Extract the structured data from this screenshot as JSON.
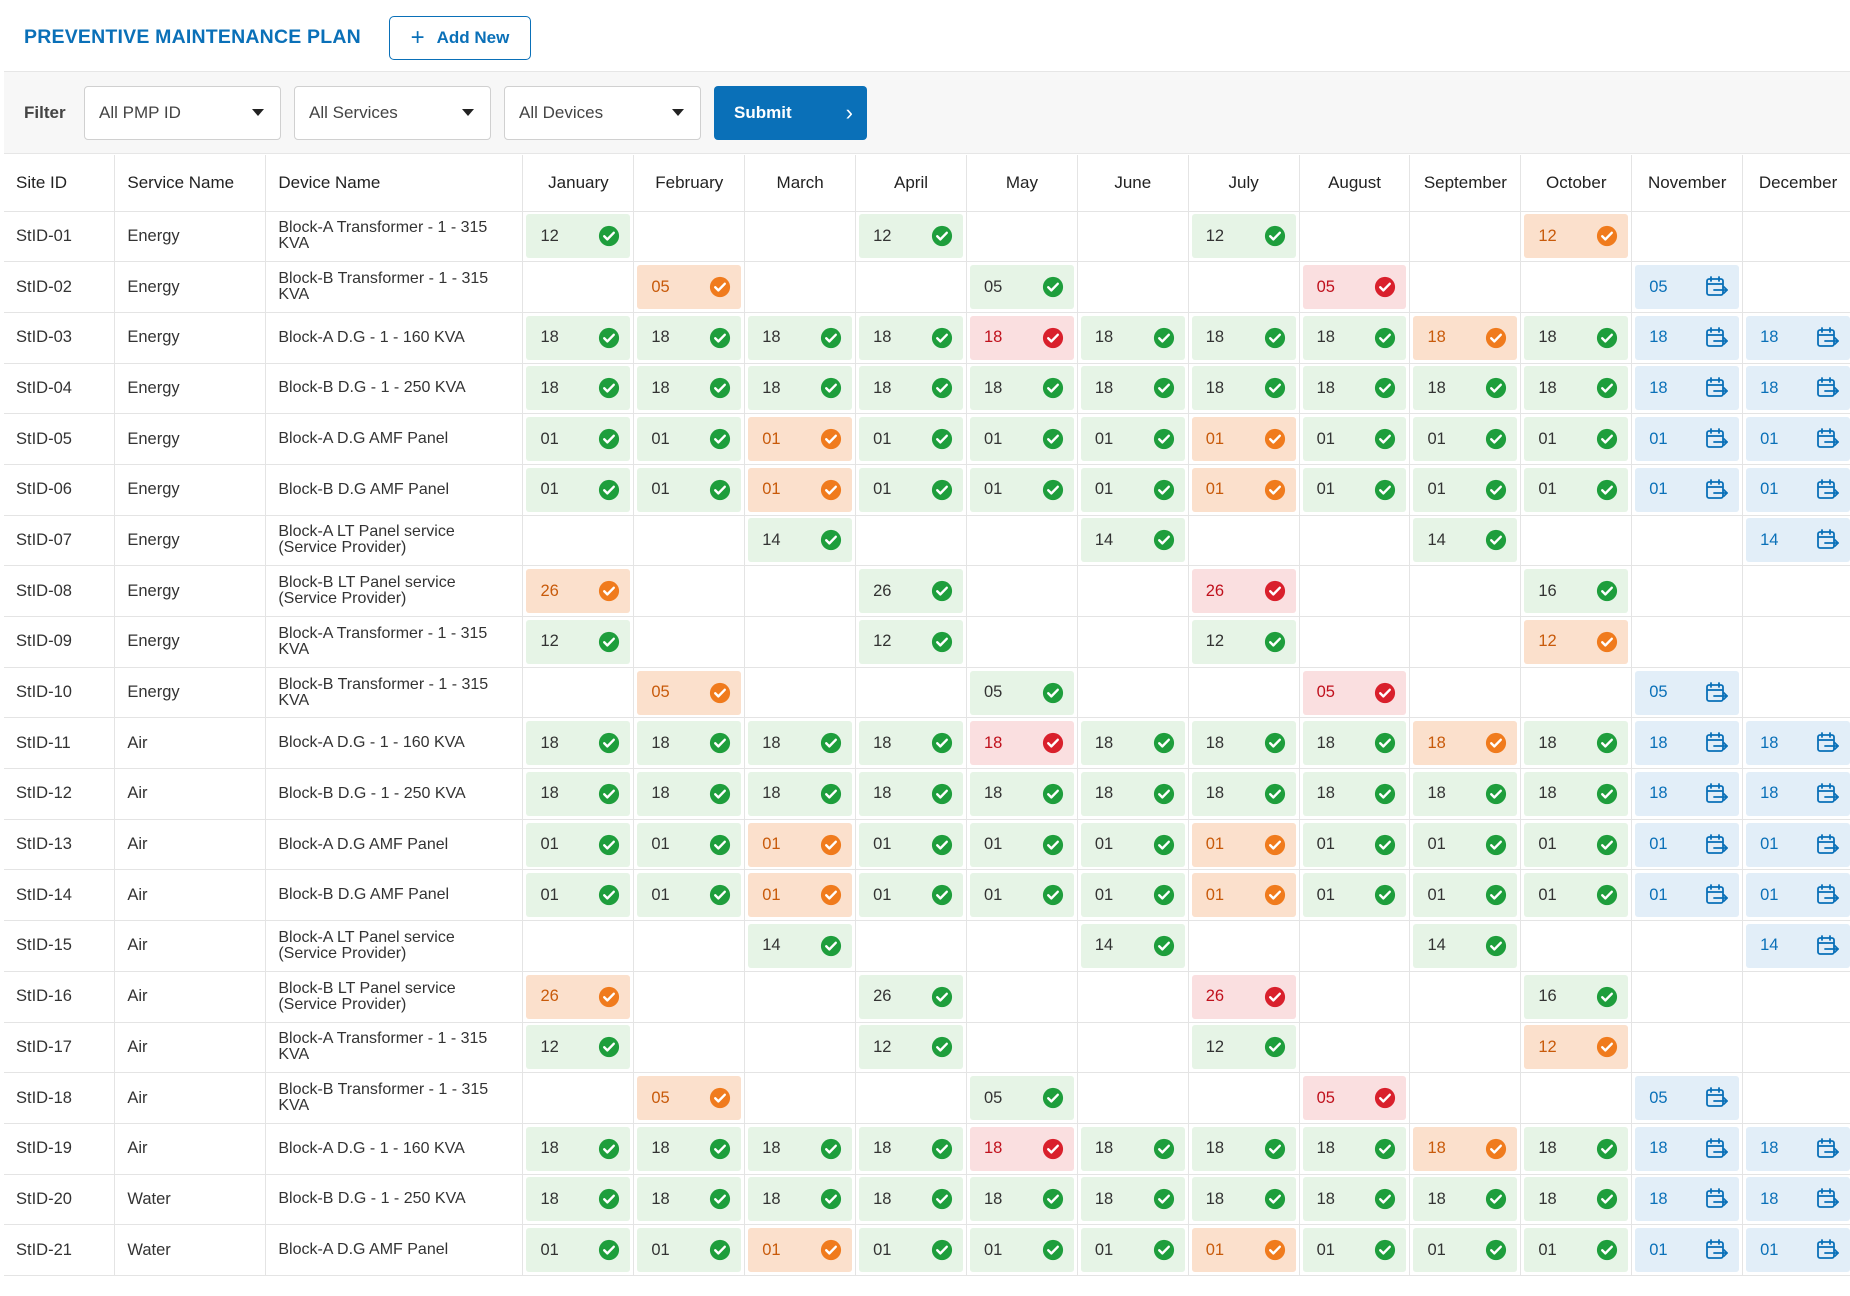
{
  "header": {
    "title": "PREVENTIVE MAINTENANCE PLAN",
    "add_label": "Add New"
  },
  "filter": {
    "label": "Filter",
    "pmp": "All PMP ID",
    "services": "All Services",
    "devices": "All Devices",
    "submit_label": "Submit"
  },
  "columns": [
    "Site ID",
    "Service Name",
    "Device Name"
  ],
  "months": [
    "January",
    "February",
    "March",
    "April",
    "May",
    "June",
    "July",
    "August",
    "September",
    "October",
    "November",
    "December"
  ],
  "status_colors": {
    "green": "#1e9e3c",
    "orange": "#f07b1d",
    "red": "#d9202c",
    "blue": "#0a70b8"
  },
  "status_icons": {
    "green": "check-circle-icon",
    "orange": "check-circle-icon",
    "red": "check-circle-icon",
    "blue": "calendar-arrow-icon"
  },
  "rows": [
    {
      "site": "StID-01",
      "service": "Energy",
      "device": [
        "Block-A Transformer - 1 - 315",
        "KVA"
      ],
      "cells": [
        [
          "12",
          "g"
        ],
        null,
        null,
        [
          "12",
          "g"
        ],
        null,
        null,
        [
          "12",
          "g"
        ],
        null,
        null,
        [
          "12",
          "o"
        ],
        null,
        null
      ]
    },
    {
      "site": "StID-02",
      "service": "Energy",
      "device": [
        "Block-B Transformer - 1 - 315",
        "KVA"
      ],
      "cells": [
        null,
        [
          "05",
          "o"
        ],
        null,
        null,
        [
          "05",
          "g"
        ],
        null,
        null,
        [
          "05",
          "r"
        ],
        null,
        null,
        [
          "05",
          "b"
        ],
        null
      ]
    },
    {
      "site": "StID-03",
      "service": "Energy",
      "device": [
        "Block-A D.G - 1 - 160 KVA"
      ],
      "cells": [
        [
          "18",
          "g"
        ],
        [
          "18",
          "g"
        ],
        [
          "18",
          "g"
        ],
        [
          "18",
          "g"
        ],
        [
          "18",
          "r"
        ],
        [
          "18",
          "g"
        ],
        [
          "18",
          "g"
        ],
        [
          "18",
          "g"
        ],
        [
          "18",
          "o"
        ],
        [
          "18",
          "g"
        ],
        [
          "18",
          "b"
        ],
        [
          "18",
          "b"
        ]
      ]
    },
    {
      "site": "StID-04",
      "service": "Energy",
      "device": [
        "Block-B D.G - 1 - 250 KVA"
      ],
      "cells": [
        [
          "18",
          "g"
        ],
        [
          "18",
          "g"
        ],
        [
          "18",
          "g"
        ],
        [
          "18",
          "g"
        ],
        [
          "18",
          "g"
        ],
        [
          "18",
          "g"
        ],
        [
          "18",
          "g"
        ],
        [
          "18",
          "g"
        ],
        [
          "18",
          "g"
        ],
        [
          "18",
          "g"
        ],
        [
          "18",
          "b"
        ],
        [
          "18",
          "b"
        ]
      ]
    },
    {
      "site": "StID-05",
      "service": "Energy",
      "device": [
        "Block-A D.G AMF Panel"
      ],
      "cells": [
        [
          "01",
          "g"
        ],
        [
          "01",
          "g"
        ],
        [
          "01",
          "o"
        ],
        [
          "01",
          "g"
        ],
        [
          "01",
          "g"
        ],
        [
          "01",
          "g"
        ],
        [
          "01",
          "o"
        ],
        [
          "01",
          "g"
        ],
        [
          "01",
          "g"
        ],
        [
          "01",
          "g"
        ],
        [
          "01",
          "b"
        ],
        [
          "01",
          "b"
        ]
      ]
    },
    {
      "site": "StID-06",
      "service": "Energy",
      "device": [
        "Block-B D.G AMF Panel"
      ],
      "cells": [
        [
          "01",
          "g"
        ],
        [
          "01",
          "g"
        ],
        [
          "01",
          "o"
        ],
        [
          "01",
          "g"
        ],
        [
          "01",
          "g"
        ],
        [
          "01",
          "g"
        ],
        [
          "01",
          "o"
        ],
        [
          "01",
          "g"
        ],
        [
          "01",
          "g"
        ],
        [
          "01",
          "g"
        ],
        [
          "01",
          "b"
        ],
        [
          "01",
          "b"
        ]
      ]
    },
    {
      "site": "StID-07",
      "service": "Energy",
      "device": [
        "Block-A LT Panel service",
        "(Service Provider)"
      ],
      "cells": [
        null,
        null,
        [
          "14",
          "g"
        ],
        null,
        null,
        [
          "14",
          "g"
        ],
        null,
        null,
        [
          "14",
          "g"
        ],
        null,
        null,
        [
          "14",
          "b"
        ]
      ]
    },
    {
      "site": "StID-08",
      "service": "Energy",
      "device": [
        "Block-B LT Panel service",
        "(Service Provider)"
      ],
      "cells": [
        [
          "26",
          "o"
        ],
        null,
        null,
        [
          "26",
          "g"
        ],
        null,
        null,
        [
          "26",
          "r"
        ],
        null,
        null,
        [
          "16",
          "g"
        ],
        null,
        null
      ]
    },
    {
      "site": "StID-09",
      "service": "Energy",
      "device": [
        "Block-A Transformer - 1 - 315",
        "KVA"
      ],
      "cells": [
        [
          "12",
          "g"
        ],
        null,
        null,
        [
          "12",
          "g"
        ],
        null,
        null,
        [
          "12",
          "g"
        ],
        null,
        null,
        [
          "12",
          "o"
        ],
        null,
        null
      ]
    },
    {
      "site": "StID-10",
      "service": "Energy",
      "device": [
        "Block-B Transformer - 1 - 315",
        "KVA"
      ],
      "cells": [
        null,
        [
          "05",
          "o"
        ],
        null,
        null,
        [
          "05",
          "g"
        ],
        null,
        null,
        [
          "05",
          "r"
        ],
        null,
        null,
        [
          "05",
          "b"
        ],
        null
      ]
    },
    {
      "site": "StID-11",
      "service": "Air",
      "device": [
        "Block-A D.G - 1 - 160 KVA"
      ],
      "cells": [
        [
          "18",
          "g"
        ],
        [
          "18",
          "g"
        ],
        [
          "18",
          "g"
        ],
        [
          "18",
          "g"
        ],
        [
          "18",
          "r"
        ],
        [
          "18",
          "g"
        ],
        [
          "18",
          "g"
        ],
        [
          "18",
          "g"
        ],
        [
          "18",
          "o"
        ],
        [
          "18",
          "g"
        ],
        [
          "18",
          "b"
        ],
        [
          "18",
          "b"
        ]
      ]
    },
    {
      "site": "StID-12",
      "service": "Air",
      "device": [
        "Block-B D.G - 1 - 250 KVA"
      ],
      "cells": [
        [
          "18",
          "g"
        ],
        [
          "18",
          "g"
        ],
        [
          "18",
          "g"
        ],
        [
          "18",
          "g"
        ],
        [
          "18",
          "g"
        ],
        [
          "18",
          "g"
        ],
        [
          "18",
          "g"
        ],
        [
          "18",
          "g"
        ],
        [
          "18",
          "g"
        ],
        [
          "18",
          "g"
        ],
        [
          "18",
          "b"
        ],
        [
          "18",
          "b"
        ]
      ]
    },
    {
      "site": "StID-13",
      "service": "Air",
      "device": [
        "Block-A D.G AMF Panel"
      ],
      "cells": [
        [
          "01",
          "g"
        ],
        [
          "01",
          "g"
        ],
        [
          "01",
          "o"
        ],
        [
          "01",
          "g"
        ],
        [
          "01",
          "g"
        ],
        [
          "01",
          "g"
        ],
        [
          "01",
          "o"
        ],
        [
          "01",
          "g"
        ],
        [
          "01",
          "g"
        ],
        [
          "01",
          "g"
        ],
        [
          "01",
          "b"
        ],
        [
          "01",
          "b"
        ]
      ]
    },
    {
      "site": "StID-14",
      "service": "Air",
      "device": [
        "Block-B D.G AMF Panel"
      ],
      "cells": [
        [
          "01",
          "g"
        ],
        [
          "01",
          "g"
        ],
        [
          "01",
          "o"
        ],
        [
          "01",
          "g"
        ],
        [
          "01",
          "g"
        ],
        [
          "01",
          "g"
        ],
        [
          "01",
          "o"
        ],
        [
          "01",
          "g"
        ],
        [
          "01",
          "g"
        ],
        [
          "01",
          "g"
        ],
        [
          "01",
          "b"
        ],
        [
          "01",
          "b"
        ]
      ]
    },
    {
      "site": "StID-15",
      "service": "Air",
      "device": [
        "Block-A LT Panel service",
        "(Service Provider)"
      ],
      "cells": [
        null,
        null,
        [
          "14",
          "g"
        ],
        null,
        null,
        [
          "14",
          "g"
        ],
        null,
        null,
        [
          "14",
          "g"
        ],
        null,
        null,
        [
          "14",
          "b"
        ]
      ]
    },
    {
      "site": "StID-16",
      "service": "Air",
      "device": [
        "Block-B LT Panel service",
        "(Service Provider)"
      ],
      "cells": [
        [
          "26",
          "o"
        ],
        null,
        null,
        [
          "26",
          "g"
        ],
        null,
        null,
        [
          "26",
          "r"
        ],
        null,
        null,
        [
          "16",
          "g"
        ],
        null,
        null
      ]
    },
    {
      "site": "StID-17",
      "service": "Air",
      "device": [
        "Block-A Transformer - 1 - 315",
        "KVA"
      ],
      "cells": [
        [
          "12",
          "g"
        ],
        null,
        null,
        [
          "12",
          "g"
        ],
        null,
        null,
        [
          "12",
          "g"
        ],
        null,
        null,
        [
          "12",
          "o"
        ],
        null,
        null
      ]
    },
    {
      "site": "StID-18",
      "service": "Air",
      "device": [
        "Block-B Transformer - 1 - 315",
        "KVA"
      ],
      "cells": [
        null,
        [
          "05",
          "o"
        ],
        null,
        null,
        [
          "05",
          "g"
        ],
        null,
        null,
        [
          "05",
          "r"
        ],
        null,
        null,
        [
          "05",
          "b"
        ],
        null
      ]
    },
    {
      "site": "StID-19",
      "service": "Air",
      "device": [
        "Block-A D.G - 1 - 160 KVA"
      ],
      "cells": [
        [
          "18",
          "g"
        ],
        [
          "18",
          "g"
        ],
        [
          "18",
          "g"
        ],
        [
          "18",
          "g"
        ],
        [
          "18",
          "r"
        ],
        [
          "18",
          "g"
        ],
        [
          "18",
          "g"
        ],
        [
          "18",
          "g"
        ],
        [
          "18",
          "o"
        ],
        [
          "18",
          "g"
        ],
        [
          "18",
          "b"
        ],
        [
          "18",
          "b"
        ]
      ]
    },
    {
      "site": "StID-20",
      "service": "Water",
      "device": [
        "Block-B D.G - 1 - 250 KVA"
      ],
      "cells": [
        [
          "18",
          "g"
        ],
        [
          "18",
          "g"
        ],
        [
          "18",
          "g"
        ],
        [
          "18",
          "g"
        ],
        [
          "18",
          "g"
        ],
        [
          "18",
          "g"
        ],
        [
          "18",
          "g"
        ],
        [
          "18",
          "g"
        ],
        [
          "18",
          "g"
        ],
        [
          "18",
          "g"
        ],
        [
          "18",
          "b"
        ],
        [
          "18",
          "b"
        ]
      ]
    },
    {
      "site": "StID-21",
      "service": "Water",
      "device": [
        "Block-A D.G AMF Panel"
      ],
      "cells": [
        [
          "01",
          "g"
        ],
        [
          "01",
          "g"
        ],
        [
          "01",
          "o"
        ],
        [
          "01",
          "g"
        ],
        [
          "01",
          "g"
        ],
        [
          "01",
          "g"
        ],
        [
          "01",
          "o"
        ],
        [
          "01",
          "g"
        ],
        [
          "01",
          "g"
        ],
        [
          "01",
          "g"
        ],
        [
          "01",
          "b"
        ],
        [
          "01",
          "b"
        ]
      ]
    }
  ]
}
